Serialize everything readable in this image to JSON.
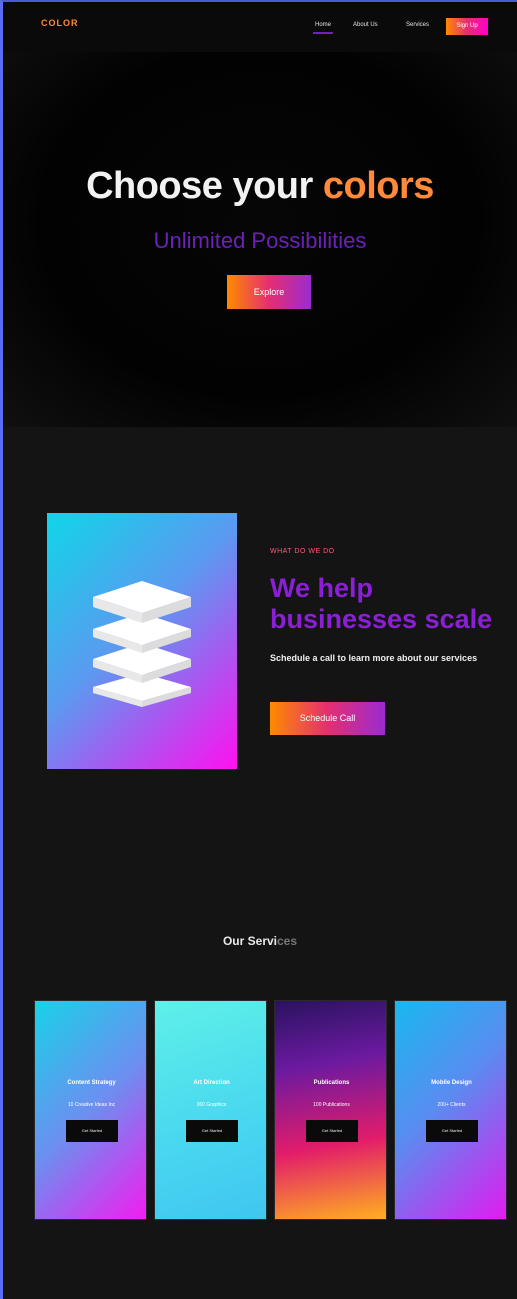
{
  "nav": {
    "logo": "COLOR",
    "links": [
      "Home",
      "About Us",
      "Services"
    ],
    "signup": "Sign Up"
  },
  "hero": {
    "title_part1": "Choose your ",
    "title_part2": "colors",
    "subtitle": "Unlimited Possibilities",
    "cta": "Explore"
  },
  "about": {
    "eyebrow": "WHAT DO WE DO",
    "title": "We help businesses scale",
    "text": "Schedule a call to learn more about our services",
    "cta": "Schedule Call",
    "image_icon": "layers-icon"
  },
  "services": {
    "heading_part1": "Our Servi",
    "heading_part2": "ces",
    "cards": [
      {
        "title": "Content Strategy",
        "subtitle": "10 Creative Ideas Inc",
        "button": "Get Started"
      },
      {
        "title": "Art Direction",
        "subtitle": "360 Graphics",
        "button": "Get Started"
      },
      {
        "title": "Publications",
        "subtitle": "100 Publications",
        "button": "Get Started"
      },
      {
        "title": "Mobile Design",
        "subtitle": "200+ Clients",
        "button": "Get Started"
      }
    ]
  },
  "colors": {
    "accent_orange": "#ff8a3a",
    "accent_purple": "#8a1fd6",
    "background": "#141414"
  }
}
